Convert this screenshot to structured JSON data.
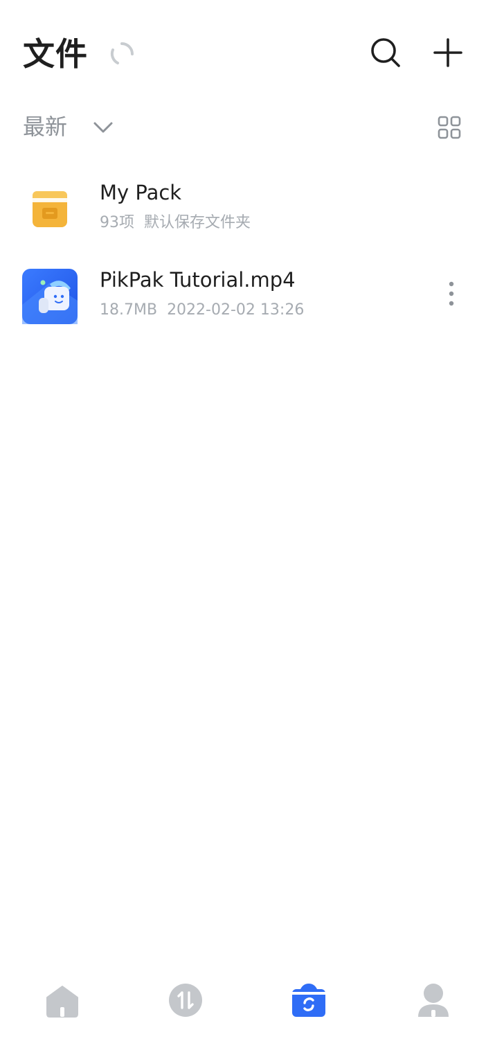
{
  "header": {
    "title": "文件",
    "icons": {
      "loading": "loading-spinner-icon",
      "search": "search-icon",
      "add": "plus-icon"
    }
  },
  "sort": {
    "label": "最新",
    "icons": {
      "dropdown": "chevron-down-icon",
      "view": "grid-view-icon"
    }
  },
  "files": [
    {
      "name": "My Pack",
      "count": "93项",
      "description": "默认保存文件夹",
      "icon": "folder-icon"
    },
    {
      "name": "PikPak Tutorial.mp4",
      "size": "18.7MB",
      "date": "2022-02-02 13:26",
      "icon": "video-thumbnail-icon"
    }
  ],
  "nav": {
    "items": [
      {
        "id": "home",
        "icon": "home-icon"
      },
      {
        "id": "transfer",
        "icon": "transfer-icon"
      },
      {
        "id": "files",
        "icon": "files-icon",
        "active": true
      },
      {
        "id": "profile",
        "icon": "profile-icon"
      }
    ]
  },
  "colors": {
    "text_primary": "#1f1f1f",
    "text_secondary": "#a6abb1",
    "sort_text": "#8e9399",
    "icon_gray": "#c4c7cb",
    "accent_blue": "#2f6df6",
    "folder_yellow": "#f4b43a"
  }
}
